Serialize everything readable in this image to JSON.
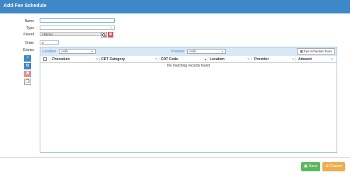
{
  "dialog": {
    "title": "Add Fee Schedule"
  },
  "form": {
    "name_label": "Name",
    "name_value": "",
    "type_label": "Type",
    "type_value": "",
    "parent_label": "Parent",
    "parent_value": "<None>",
    "order_label": "Order",
    "order_value": "0",
    "entries_label": "Entries"
  },
  "filters": {
    "location_label": "Location",
    "location_value": "<All>",
    "provider_label": "Provider",
    "provider_value": "<All>",
    "tools_label": "Fee Schedule Tools"
  },
  "table": {
    "columns": [
      "Procedure",
      "CDT Category",
      "CDT Code",
      "Location",
      "Provider",
      "Amount"
    ],
    "empty_message": "No matching records found"
  },
  "footer": {
    "save_label": "Save",
    "cancel_label": "Cancel"
  },
  "colors": {
    "header": "#3f88c7",
    "save": "#5cb85c",
    "cancel": "#f0ad4e",
    "danger": "#d9534f"
  }
}
